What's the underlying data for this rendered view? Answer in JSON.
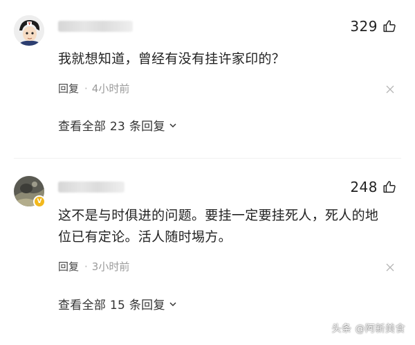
{
  "comments": [
    {
      "username": "",
      "likes": "329",
      "text": "我就想知道，曾经有没有挂许家印的？",
      "reply_label": "回复",
      "separator": "·",
      "time": "4小时前",
      "view_replies": "查看全部 23 条回复"
    },
    {
      "username": "",
      "likes": "248",
      "text": "这不是与时俱进的问题。要挂一定要挂死人，死人的地位已有定论。活人随时埸方。",
      "reply_label": "回复",
      "separator": "·",
      "time": "3小时前",
      "view_replies": "查看全部 15 条回复"
    }
  ],
  "watermark": "头条 @阿新美食",
  "colors": {
    "text": "#222222",
    "meta": "#9a9a9a",
    "badge": "#f2b81c"
  },
  "icons": [
    "thumbs-up-icon",
    "close-icon",
    "chevron-down-icon",
    "verified-badge-icon"
  ]
}
